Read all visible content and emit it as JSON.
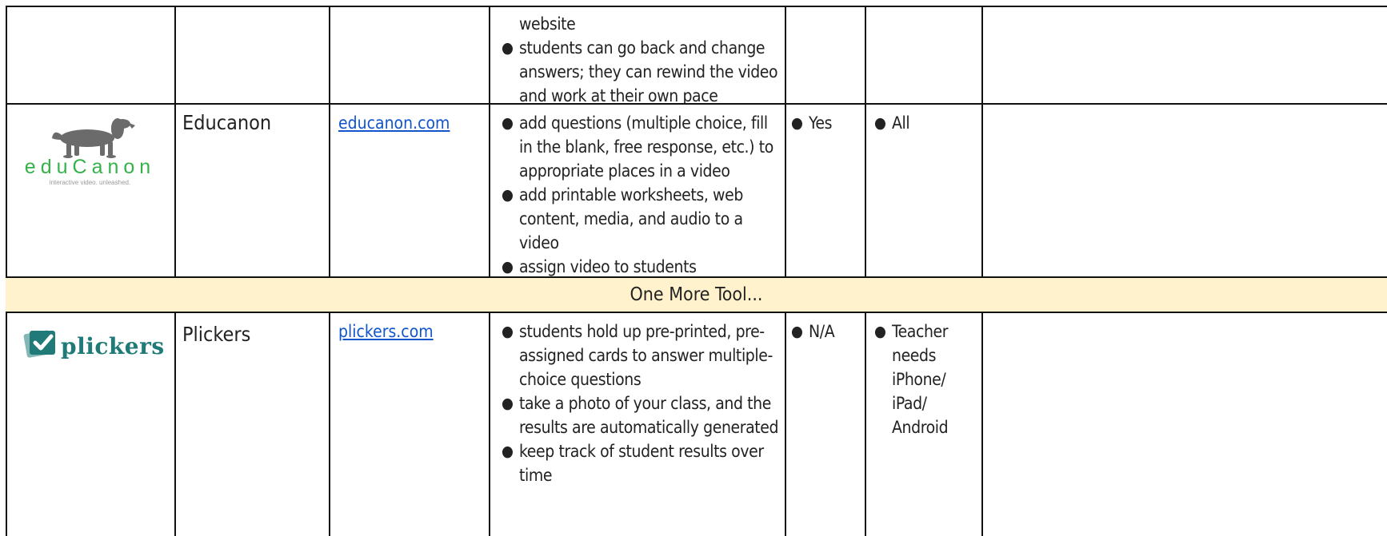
{
  "rows": {
    "top": {
      "features_cont_line": "website",
      "features": [
        "students can go back and change answers; they can rewind the video and work at their own pace"
      ]
    },
    "educanon": {
      "logo_text": "eduCanon",
      "logo_tagline": "interactive video. unleashed.",
      "name": "Educanon",
      "link": "educanon.com",
      "features": [
        "add questions (multiple choice, fill in the blank, free response, etc.) to appropriate places in a video",
        "add printable worksheets, web content, media, and audio to a video",
        "assign video to students"
      ],
      "free": "Yes",
      "devices": "All"
    },
    "banner": {
      "text": "One More Tool..."
    },
    "plickers": {
      "logo_text": "plickers",
      "name": "Plickers",
      "link": "plickers.com",
      "features": [
        "students hold up pre-printed, pre-assigned cards to answer multiple-choice questions",
        "take a photo of your class, and the results are automatically generated",
        "keep track of student results over time"
      ],
      "free": "N/A",
      "devices": "Teacher needs iPhone/ iPad/ Android"
    }
  },
  "colors": {
    "border": "#111111",
    "link": "#1155cc",
    "banner_bg": "#fff2cc",
    "educanon_green": "#35b24a",
    "plickers_teal": "#1f7a78"
  },
  "icons": {
    "educanon_logo": "dachshund-dog-icon",
    "plickers_logo": "checkmark-card-icon"
  }
}
